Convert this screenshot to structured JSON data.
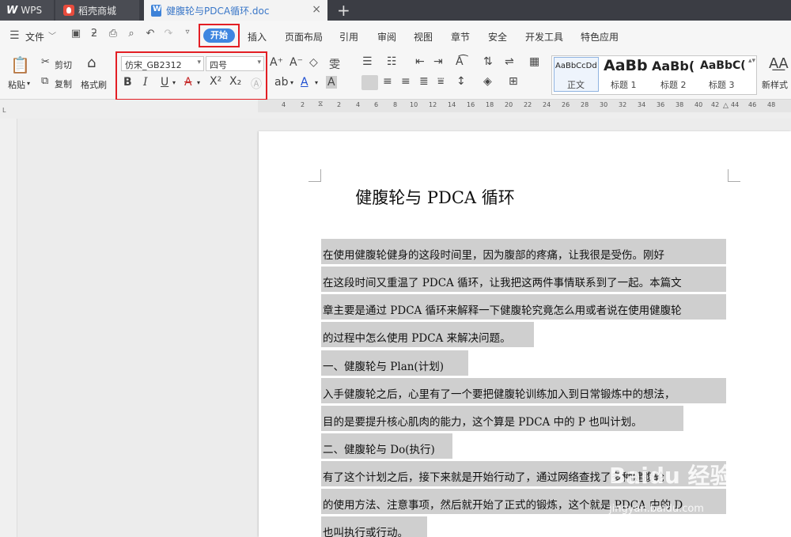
{
  "tabs": {
    "wps": "WPS",
    "daoke": "稻壳商城",
    "doc": "健腹轮与PDCA循环.doc",
    "close": "×",
    "new": "+"
  },
  "menu": {
    "file": "文件",
    "start": "开始",
    "items": [
      "插入",
      "页面布局",
      "引用",
      "审阅",
      "视图",
      "章节",
      "安全",
      "开发工具",
      "特色应用"
    ]
  },
  "ribbon": {
    "paste": "粘贴",
    "cut": "剪切",
    "copy": "复制",
    "format_painter": "格式刷",
    "font_name": "仿宋_GB2312",
    "font_size": "四号",
    "styles": [
      {
        "preview": "AaBbCcDd",
        "label": "正文"
      },
      {
        "preview": "AaBb",
        "label": "标题 1"
      },
      {
        "preview": "AaBb(",
        "label": "标题 2"
      },
      {
        "preview": "AaBbC(",
        "label": "标题 3"
      }
    ],
    "new_style": "新样式"
  },
  "ruler": {
    "ticks": [
      "4",
      "2",
      "2",
      "4",
      "6",
      "8",
      "10",
      "12",
      "14",
      "16",
      "18",
      "20",
      "22",
      "24",
      "26",
      "28",
      "30",
      "32",
      "34",
      "36",
      "38",
      "40",
      "42",
      "44",
      "46",
      "48"
    ]
  },
  "document": {
    "title": "健腹轮与 PDCA 循环",
    "lines": [
      "在使用健腹轮健身的这段时间里，因为腹部的疼痛，让我很是受伤。刚好",
      "在这段时间又重温了 PDCA 循环，让我把这两件事情联系到了一起。本篇文",
      "章主要是通过 PDCA 循环来解释一下健腹轮究竟怎么用或者说在使用健腹轮",
      "的过程中怎么使用 PDCA 来解决问题。",
      "一、健腹轮与 Plan(计划)",
      "入手健腹轮之后，心里有了一个要把健腹轮训练加入到日常锻炼中的想法，",
      "目的是要提升核心肌肉的能力，这个算是 PDCA 中的 P 也叫计划。",
      "二、健腹轮与 Do(执行)",
      "有了这个计划之后，接下来就是开始行动了，通过网络查找了多种健腹轮",
      "的使用方法、注意事项，然后就开始了正式的锻炼，这个就是 PDCA 中的 D",
      "也叫执行或行动。"
    ]
  },
  "watermark": {
    "text": "Baidu 经验",
    "url": "jingyan.baidu.com"
  }
}
